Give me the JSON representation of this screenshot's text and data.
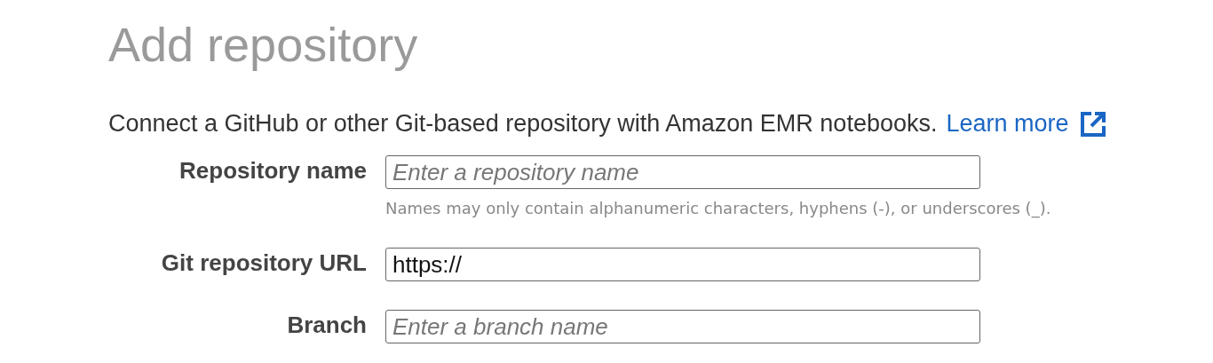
{
  "title": "Add repository",
  "description": {
    "text": "Connect a GitHub or other Git-based repository with Amazon EMR notebooks.",
    "link": "Learn more"
  },
  "fields": [
    {
      "label": "Repository name",
      "placeholder": "Enter a repository name",
      "hint": "Names may only contain alphanumeric characters, hyphens (-), or underscores (_)."
    },
    {
      "label": "Git repository URL",
      "value": "https://"
    },
    {
      "label": "Branch",
      "placeholder": "Enter a branch name"
    }
  ]
}
